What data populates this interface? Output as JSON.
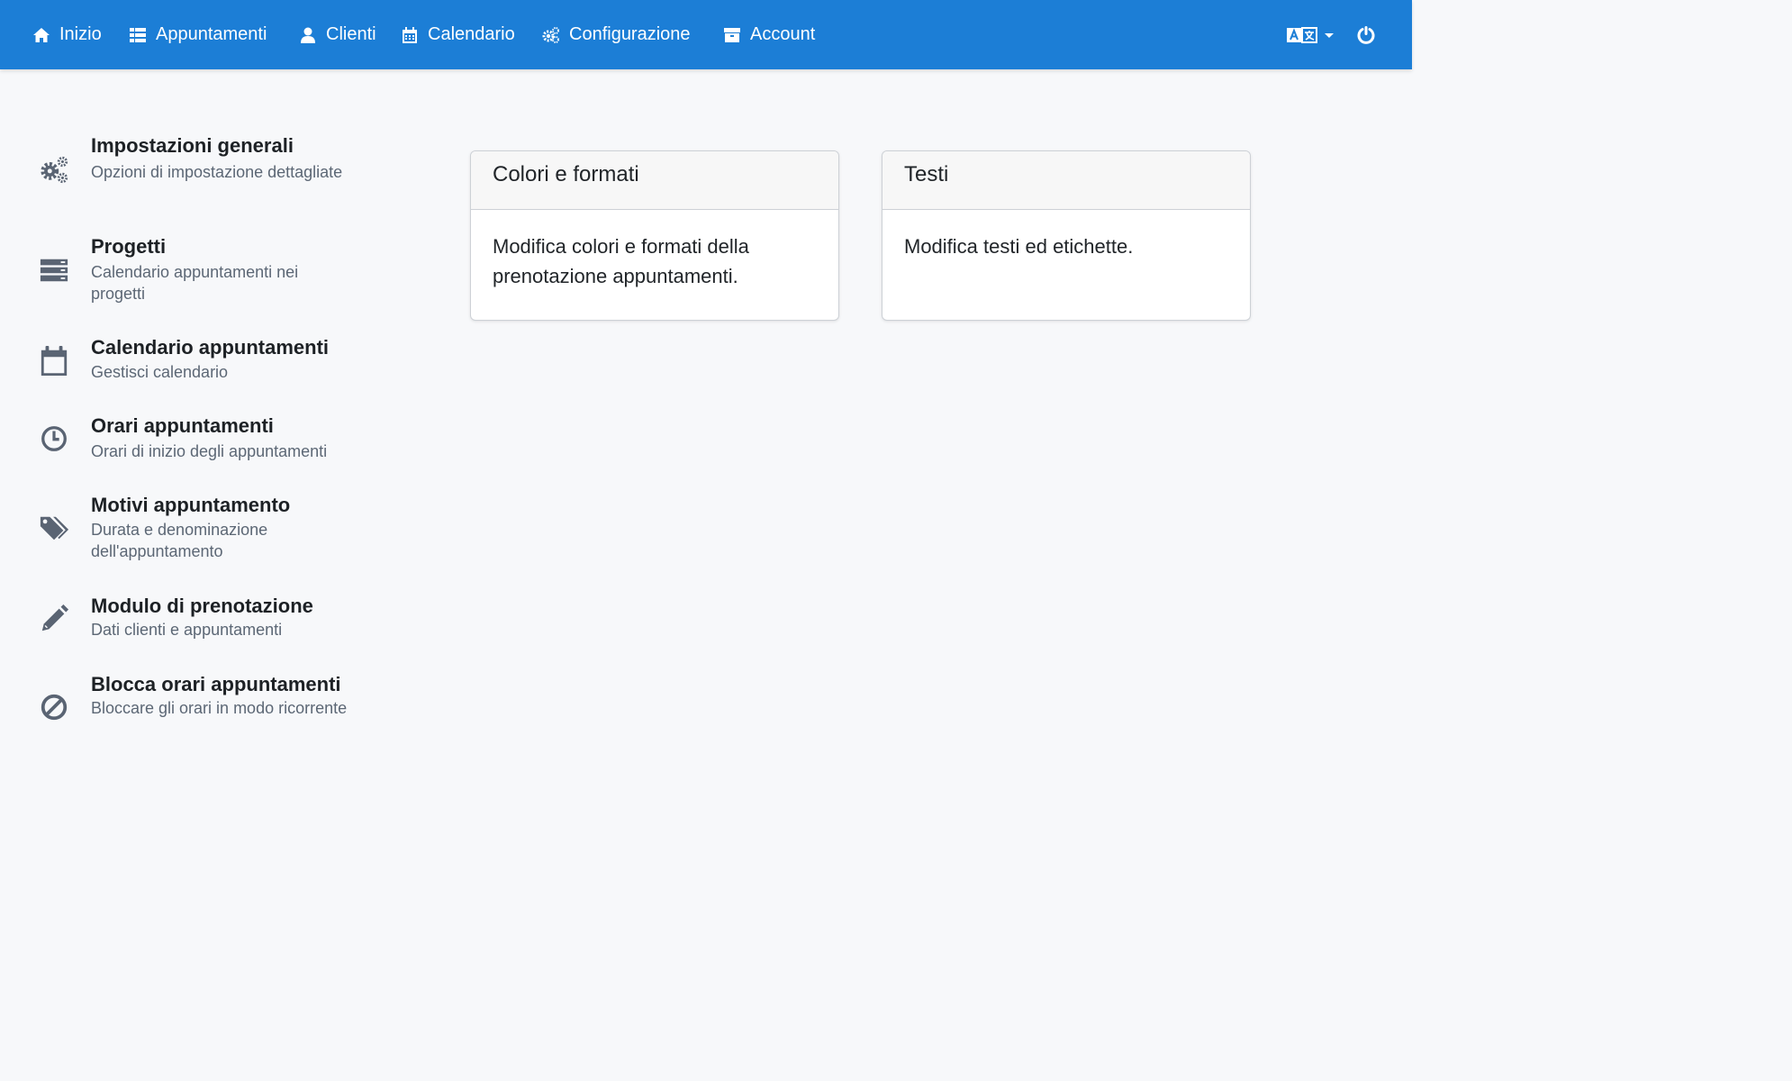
{
  "nav": {
    "items": [
      {
        "label": "Inizio",
        "icon": "home-icon"
      },
      {
        "label": "Appuntamenti",
        "icon": "list-icon"
      },
      {
        "label": "Clienti",
        "icon": "user-icon"
      },
      {
        "label": "Calendario",
        "icon": "calendar-icon"
      },
      {
        "label": "Configurazione",
        "icon": "cogs-icon"
      },
      {
        "label": "Account",
        "icon": "archive-icon"
      }
    ],
    "language_icon": "translate-icon",
    "power_icon": "power-icon",
    "color": "#1c7ed6"
  },
  "sidebar": {
    "items": [
      {
        "title": "Impostazioni generali",
        "desc": "Opzioni di impostazione dettagliate",
        "icon": "cogs-icon"
      },
      {
        "title": "Progetti",
        "desc": "Calendario appuntamenti nei progetti",
        "icon": "server-icon"
      },
      {
        "title": "Calendario appuntamenti",
        "desc": "Gestisci calendario",
        "icon": "calendar-icon"
      },
      {
        "title": "Orari appuntamenti",
        "desc": "Orari di inizio degli appuntamenti",
        "icon": "clock-icon"
      },
      {
        "title": "Motivi appuntamento",
        "desc": "Durata e denominazione dell'appuntamento",
        "icon": "tags-icon"
      },
      {
        "title": "Modulo di prenotazione",
        "desc": "Dati clienti e appuntamenti",
        "icon": "pencil-icon"
      },
      {
        "title": "Blocca orari appuntamenti",
        "desc": "Bloccare gli orari in modo ricorrente",
        "icon": "ban-icon"
      }
    ]
  },
  "cards": [
    {
      "title": "Colori e formati",
      "body": "Modifica colori e formati della prenotazione appuntamenti."
    },
    {
      "title": "Testi",
      "body": "Modifica testi ed etichette."
    }
  ]
}
